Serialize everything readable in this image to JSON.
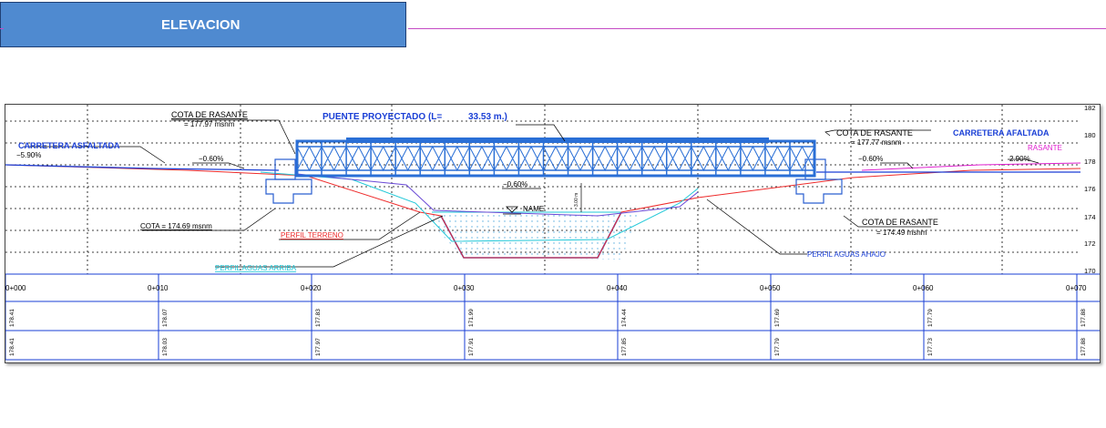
{
  "header": {
    "title": "ELEVACION"
  },
  "drawing": {
    "labels": {
      "cota_rasante_left_title": "COTA DE RASANTE",
      "cota_rasante_left_value": "= 177.97 msnm",
      "puente_proyectado": "PUENTE PROYECTADO (L=",
      "puente_length": "33.53 m.)",
      "carretera_left": "CARRETERA ASFALTADA",
      "slope_left_1": "−5.90%",
      "slope_left_2": "−0.60%",
      "cota_rasante_right_title": "COTA DE RASANTE",
      "cota_rasante_right_value": "= 177.77 msnm",
      "carretera_right": "CARRETERA AFALTADA",
      "rasante": "RASANTE",
      "slope_right_1": "−0.60%",
      "slope_right_2": "2.90%",
      "slope_center": "−0.60%",
      "name_label": "NAME",
      "height_label": "3.00 m",
      "cota_left_bottom": "COTA = 174.69 msnm",
      "perfil_terreno": "PERFIL TERRENO",
      "perfil_aguas_arriba": "PERFIL AGUAS ARRIBA",
      "cota_rasante_bottom_title": "COTA DE RASANTE",
      "cota_rasante_bottom_value": "= 174.49 msnm",
      "perfil_aguas_abajo": "PERFIL AGUAS AHAJO"
    },
    "elevation_ticks": [
      "182",
      "180",
      "178",
      "176",
      "174",
      "172",
      "170"
    ],
    "stations": [
      "0+000",
      "0+010",
      "0+020",
      "0+030",
      "0+040",
      "0+050",
      "0+060",
      "0+070"
    ],
    "row1": [
      "178.41",
      "178.07",
      "177.83",
      "171.99",
      "174.44",
      "177.69",
      "177.79",
      "177.88"
    ],
    "row2": [
      "178.41",
      "178.03",
      "177.97",
      "177.91",
      "177.85",
      "177.79",
      "177.73",
      "177.88"
    ],
    "colors": {
      "header_fill": "#4f8ad0",
      "accent_line": "#c44bc4",
      "bridge": "#2a6fd6",
      "road_blue": "#1a3fd6",
      "terrain_red": "#ee2b2b",
      "water_cyan": "#21c8d8",
      "rasante_magenta": "#e020d0",
      "concrete": "#2a5fd0"
    }
  }
}
